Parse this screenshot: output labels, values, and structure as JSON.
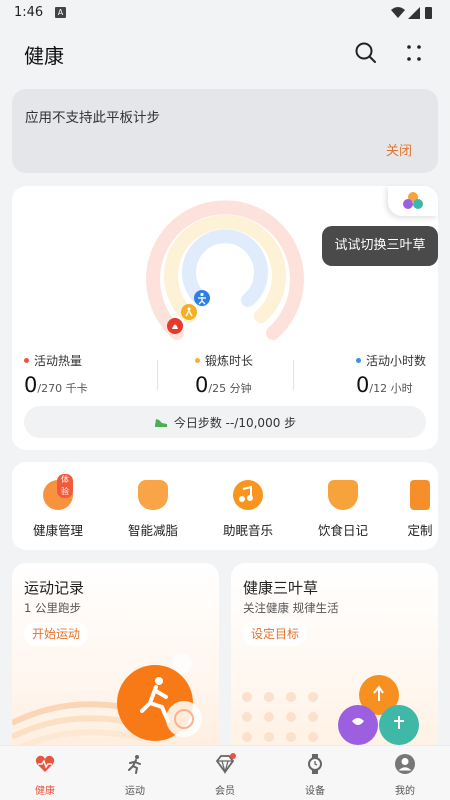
{
  "status_bar": {
    "time": "1:46",
    "a_icon": "A"
  },
  "header": {
    "title": "健康"
  },
  "notice": {
    "message": "应用不支持此平板计步",
    "close_label": "关闭"
  },
  "rings": {
    "tooltip": "试试切换三叶草",
    "stats": [
      {
        "label": "活动热量",
        "value": "0",
        "unit": "/270 千卡",
        "color": "#f0543e"
      },
      {
        "label": "锻炼时长",
        "value": "0",
        "unit": "/25 分钟",
        "color": "#f6b02c"
      },
      {
        "label": "活动小时数",
        "value": "0",
        "unit": "/12 小时",
        "color": "#3d8fe8"
      }
    ],
    "steps": "今日步数 --/10,000 步"
  },
  "tools": [
    {
      "label": "健康管理",
      "badge": "体验",
      "icon": "health-management-icon"
    },
    {
      "label": "智能减脂",
      "icon": "fat-loss-icon"
    },
    {
      "label": "助眠音乐",
      "icon": "sleep-music-icon"
    },
    {
      "label": "饮食日记",
      "icon": "diet-diary-icon"
    },
    {
      "label": "定制",
      "icon": "custom-icon"
    }
  ],
  "cards": {
    "exercise": {
      "title": "运动记录",
      "subtitle": "1 公里跑步",
      "button": "开始运动"
    },
    "trefoil": {
      "title": "健康三叶草",
      "subtitle": "关注健康 规律生活",
      "button": "设定目标"
    }
  },
  "tabs": [
    {
      "label": "健康",
      "active": true
    },
    {
      "label": "运动"
    },
    {
      "label": "会员"
    },
    {
      "label": "设备"
    },
    {
      "label": "我的"
    }
  ],
  "colors": {
    "accent": "#e3742e",
    "calories": "#f0543e",
    "exercise": "#f6b02c",
    "active_hours": "#3d8fe8"
  }
}
